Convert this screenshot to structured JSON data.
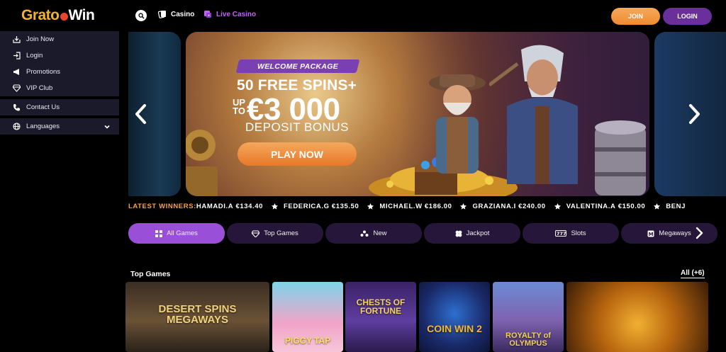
{
  "header": {
    "logo": {
      "part1": "Grato",
      "part2": "Win"
    },
    "nav": {
      "casino": "Casino",
      "live_casino": "Live Casino"
    },
    "buttons": {
      "join": "JOIN",
      "login": "LOGIN"
    }
  },
  "sidebar": {
    "items": [
      {
        "label": "Join Now",
        "icon": "join-icon"
      },
      {
        "label": "Login",
        "icon": "login-icon"
      },
      {
        "label": "Promotions",
        "icon": "megaphone-icon"
      },
      {
        "label": "VIP Club",
        "icon": "diamond-icon"
      },
      {
        "label": "Contact Us",
        "icon": "phone-icon"
      },
      {
        "label": "Languages",
        "icon": "globe-icon"
      }
    ]
  },
  "banner": {
    "tag": "WELCOME PACKAGE",
    "spins": "50 FREE SPINS+",
    "up_to": "UP TO",
    "amount": "€3 000",
    "bonus": "DEPOSIT BONUS",
    "cta": "PLAY NOW"
  },
  "ticker": {
    "label": "LATEST WINNERS:",
    "entries": [
      {
        "name": "HAMADI.A",
        "amount": "€134.40"
      },
      {
        "name": "FEDERICA.G",
        "amount": "€135.50"
      },
      {
        "name": "MICHAEL.W",
        "amount": "€186.00"
      },
      {
        "name": "GRAZIANA.I",
        "amount": "€240.00"
      },
      {
        "name": "VALENTINA.A",
        "amount": "€150.00"
      },
      {
        "name": "BENJ",
        "amount": ""
      }
    ]
  },
  "tabs": [
    {
      "label": "All Games",
      "icon": "grid-icon",
      "active": true
    },
    {
      "label": "Top Games",
      "icon": "diamond-icon",
      "active": false
    },
    {
      "label": "New",
      "icon": "sparkle-icon",
      "active": false
    },
    {
      "label": "Jackpot",
      "icon": "clover-icon",
      "active": false
    },
    {
      "label": "Slots",
      "icon": "slots-icon",
      "active": false
    },
    {
      "label": "Megaways",
      "icon": "megaways-icon",
      "active": false
    }
  ],
  "top_games": {
    "title": "Top Games",
    "all_link": "All (+6)",
    "games": [
      {
        "name": "DESERT SPINS MEGAWAYS"
      },
      {
        "name": "PIGGY TAP"
      },
      {
        "name": "CHESTS OF FORTUNE"
      },
      {
        "name": "COIN WIN 2"
      },
      {
        "name": "ROYALTY of OLYMPUS"
      },
      {
        "name": ""
      }
    ]
  },
  "colors": {
    "accent_purple": "#9a4fd9",
    "accent_orange": "#ef8b30",
    "live_casino": "#c165f0",
    "ticker_label": "#f2a347"
  }
}
